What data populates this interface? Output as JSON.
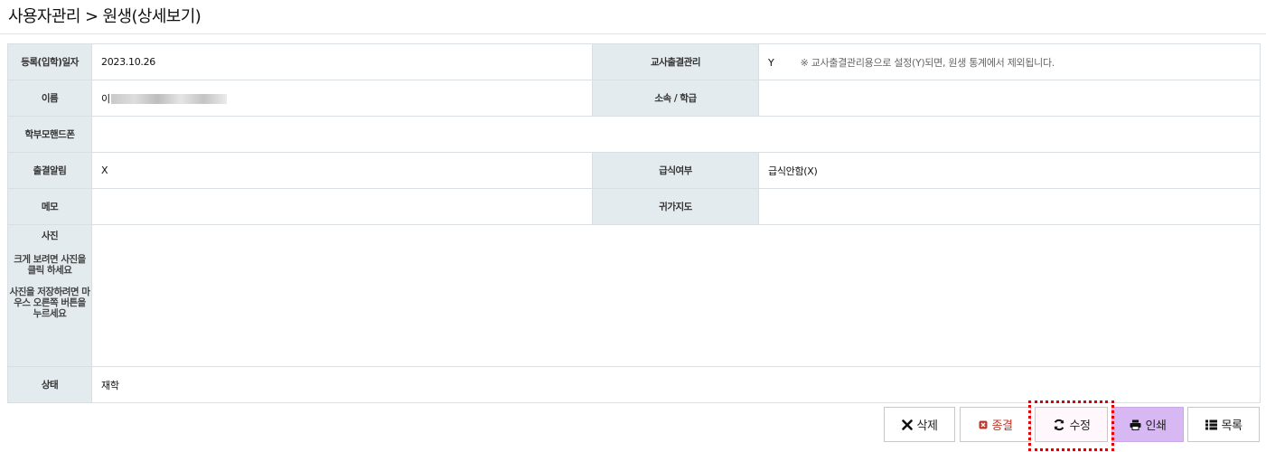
{
  "breadcrumb": {
    "section": "사용자관리",
    "separator": ">",
    "page": "원생(상세보기)"
  },
  "fields": {
    "reg_date": {
      "label": "등록(입학)일자",
      "value": "2023.10.26"
    },
    "teacher_attendance": {
      "label": "교사출결관리",
      "value": "Y",
      "note": "※ 교사출결관리용으로 설정(Y)되면, 원생 통계에서 제외됩니다."
    },
    "name": {
      "label": "이름",
      "value": "이"
    },
    "affiliation": {
      "label": "소속 / 학급",
      "value": ""
    },
    "parent_phone": {
      "label": "학부모핸드폰",
      "value": ""
    },
    "attendance_alert": {
      "label": "출결알림",
      "value": "X"
    },
    "meal": {
      "label": "급식여부",
      "value": "급식안함(X)"
    },
    "memo": {
      "label": "메모",
      "value": ""
    },
    "home_guidance": {
      "label": "귀가지도",
      "value": ""
    },
    "photo": {
      "label": "사진",
      "help1": "크게 보려면 사진을 클릭 하세요",
      "help2": "사진을 저장하려면 마우스 오른쪽 버튼을 누르세요"
    },
    "status": {
      "label": "상태",
      "value": "재학"
    }
  },
  "buttons": {
    "delete": "삭제",
    "end": "종결",
    "edit": "수정",
    "print": "인쇄",
    "list": "목록"
  },
  "colors": {
    "header_cell": "#e4ebef",
    "print_button": "#d8b8f2",
    "focus_outline": "#e00000",
    "end_icon": "#c0392b"
  }
}
